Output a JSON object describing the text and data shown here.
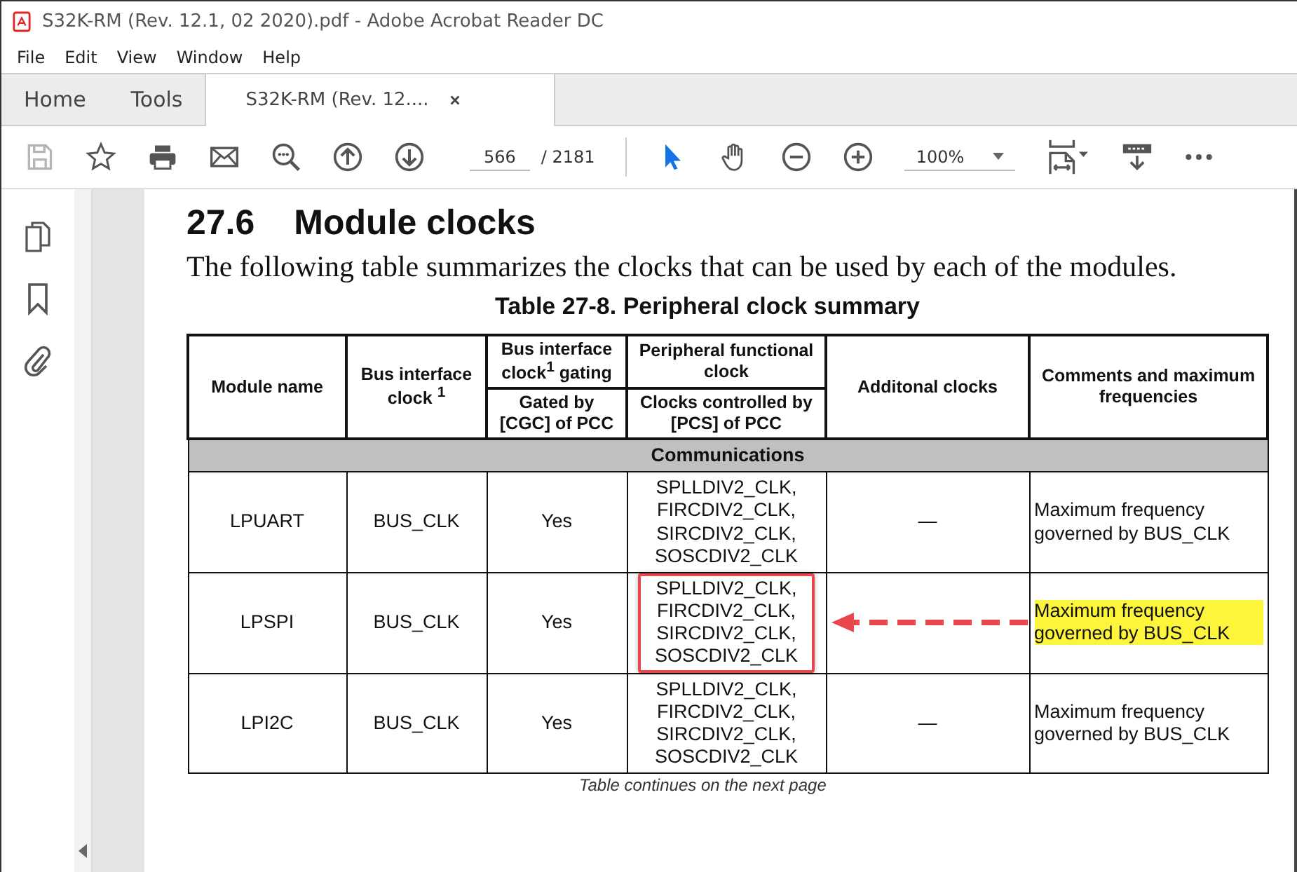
{
  "window": {
    "title": "S32K-RM (Rev. 12.1, 02 2020).pdf - Adobe Acrobat Reader DC"
  },
  "menu": [
    "File",
    "Edit",
    "View",
    "Window",
    "Help"
  ],
  "tabs": [
    {
      "label": "Home",
      "selected": false,
      "kind": "nav"
    },
    {
      "label": "Tools",
      "selected": false,
      "kind": "nav"
    },
    {
      "label": "S32K-RM (Rev. 12....",
      "selected": true,
      "kind": "document"
    }
  ],
  "toolbar": {
    "save": {
      "disabled": true
    },
    "select_tool": {
      "selected": true
    },
    "hand_tool": {
      "selected": false
    },
    "page_number": "566",
    "page_count": "/ 2181",
    "zoom": "100%"
  },
  "document": {
    "heading_number": "27.6",
    "heading": "Module clocks",
    "intro": "The following table summarizes the clocks that can be used by each of the modules.",
    "table_caption": "Table 27-8.  Peripheral clock summary",
    "table": {
      "columns": {
        "module": "Module name",
        "bus_clock": "Bus interface clock $^{1}$",
        "gating_group": "Bus interface clock$^{1}$ gating",
        "gating": "Gated by [CGC] of PCC",
        "pfc_group": "Peripheral functional clock",
        "pfc": "Clocks controlled by [PCS] of PCC",
        "additional": "Additonal clocks",
        "comments": "Comments and maximum frequencies"
      },
      "section": "Communications",
      "rows": [
        {
          "module": "LPUART",
          "bus_clock": "BUS_CLK",
          "gating": "Yes",
          "pfc": [
            "SPLLDIV2_CLK,",
            "FIRCDIV2_CLK,",
            "SIRCDIV2_CLK,",
            "SOSCDIV2_CLK"
          ],
          "additional": "—",
          "comments": "Maximum frequency governed by BUS_CLK",
          "pfc_outlined": false,
          "comments_highlighted": false
        },
        {
          "module": "LPSPI",
          "bus_clock": "BUS_CLK",
          "gating": "Yes",
          "pfc": [
            "SPLLDIV2_CLK,",
            "FIRCDIV2_CLK,",
            "SIRCDIV2_CLK,",
            "SOSCDIV2_CLK"
          ],
          "additional": "",
          "comments": "Maximum frequency governed by BUS_CLK",
          "pfc_outlined": true,
          "comments_highlighted": true
        },
        {
          "module": "LPI2C",
          "bus_clock": "BUS_CLK",
          "gating": "Yes",
          "pfc": [
            "SPLLDIV2_CLK,",
            "FIRCDIV2_CLK,",
            "SIRCDIV2_CLK,",
            "SOSCDIV2_CLK"
          ],
          "additional": "—",
          "comments": "Maximum frequency governed by BUS_CLK",
          "pfc_outlined": false,
          "comments_highlighted": false
        }
      ]
    },
    "footnote": "Table continues on the next page"
  }
}
